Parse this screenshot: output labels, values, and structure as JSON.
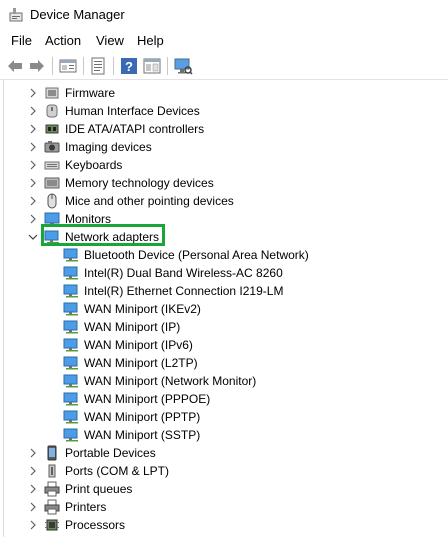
{
  "window": {
    "title": "Device Manager"
  },
  "menu": {
    "items": [
      "File",
      "Action",
      "View",
      "Help"
    ]
  },
  "toolbar": {
    "buttons": [
      "back-icon",
      "forward-icon",
      "properties-view-icon",
      "device-list-icon",
      "help-icon",
      "action-pane-icon",
      "monitor-scan-icon"
    ]
  },
  "tree": {
    "categories": [
      {
        "label": "Firmware",
        "icon": "firmware-icon",
        "expanded": false
      },
      {
        "label": "Human Interface Devices",
        "icon": "hid-icon",
        "expanded": false
      },
      {
        "label": "IDE ATA/ATAPI controllers",
        "icon": "ide-controller-icon",
        "expanded": false
      },
      {
        "label": "Imaging devices",
        "icon": "camera-icon",
        "expanded": false
      },
      {
        "label": "Keyboards",
        "icon": "keyboard-icon",
        "expanded": false
      },
      {
        "label": "Memory technology devices",
        "icon": "memory-icon",
        "expanded": false
      },
      {
        "label": "Mice and other pointing devices",
        "icon": "mouse-icon",
        "expanded": false
      },
      {
        "label": "Monitors",
        "icon": "monitor-icon",
        "expanded": false
      },
      {
        "label": "Network adapters",
        "icon": "network-adapter-icon",
        "expanded": true,
        "selected": true
      }
    ],
    "network_adapters": [
      "Bluetooth Device (Personal Area Network)",
      "Intel(R) Dual Band Wireless-AC 8260",
      "Intel(R) Ethernet Connection I219-LM",
      "WAN Miniport (IKEv2)",
      "WAN Miniport (IP)",
      "WAN Miniport (IPv6)",
      "WAN Miniport (L2TP)",
      "WAN Miniport (Network Monitor)",
      "WAN Miniport (PPPOE)",
      "WAN Miniport (PPTP)",
      "WAN Miniport (SSTP)"
    ],
    "categories_after": [
      {
        "label": "Portable Devices",
        "icon": "portable-device-icon",
        "expanded": false
      },
      {
        "label": "Ports (COM & LPT)",
        "icon": "port-icon",
        "expanded": false
      },
      {
        "label": "Print queues",
        "icon": "printer-icon",
        "expanded": false
      },
      {
        "label": "Printers",
        "icon": "printer-icon",
        "expanded": false
      },
      {
        "label": "Processors",
        "icon": "processor-icon",
        "expanded": false
      }
    ]
  },
  "colors": {
    "selection_border": "#1aa53a",
    "monitor_blue": "#3c8fd9"
  }
}
